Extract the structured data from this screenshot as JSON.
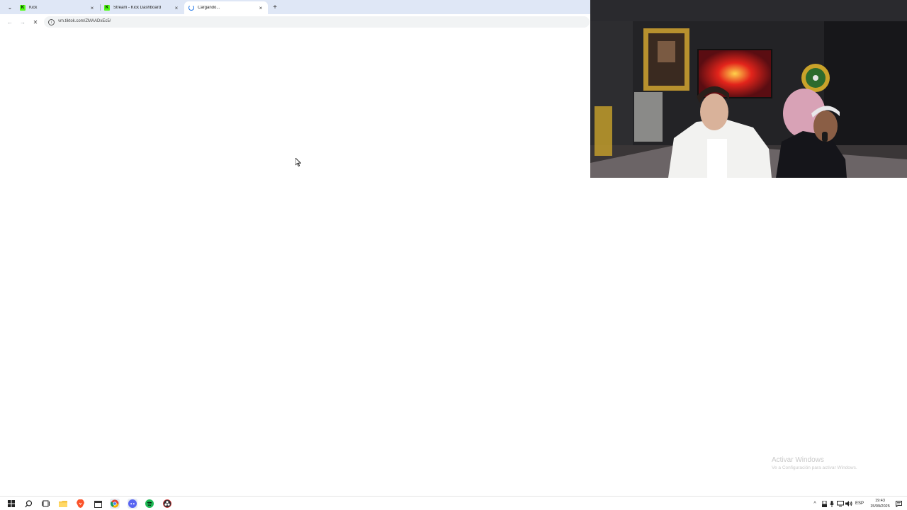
{
  "browser": {
    "tabs": [
      {
        "title": "Kick",
        "favicon": "kick-icon",
        "state": "loaded"
      },
      {
        "title": "Stream - Kick Dashboard",
        "favicon": "kick-icon",
        "state": "loaded"
      },
      {
        "title": "Cargando...",
        "favicon": "loading-spinner-icon",
        "state": "loading",
        "active": true
      }
    ],
    "address_bar": {
      "url": "vm.tiktok.com/ZMAADxEc5/"
    },
    "nav": {
      "back_icon": "back-arrow-icon",
      "forward_icon": "forward-arrow-icon",
      "stop_icon": "stop-loading-icon"
    }
  },
  "watermark": {
    "line1": "Activar Windows",
    "line2": "Ve a Configuración para activar Windows."
  },
  "taskbar": {
    "apps": [
      "windows-start-icon",
      "search-icon",
      "task-view-icon",
      "file-explorer-icon",
      "brave-icon",
      "calendar-icon",
      "chrome-icon",
      "discord-icon",
      "spotify-icon",
      "obs-icon"
    ],
    "tray": {
      "language": "ESP",
      "time": "19:43",
      "date": "15/09/2025"
    }
  },
  "colors": {
    "tabstrip_bg": "#dfe7f6",
    "kick_green": "#53fc18",
    "accent_blue": "#1a73e8"
  }
}
